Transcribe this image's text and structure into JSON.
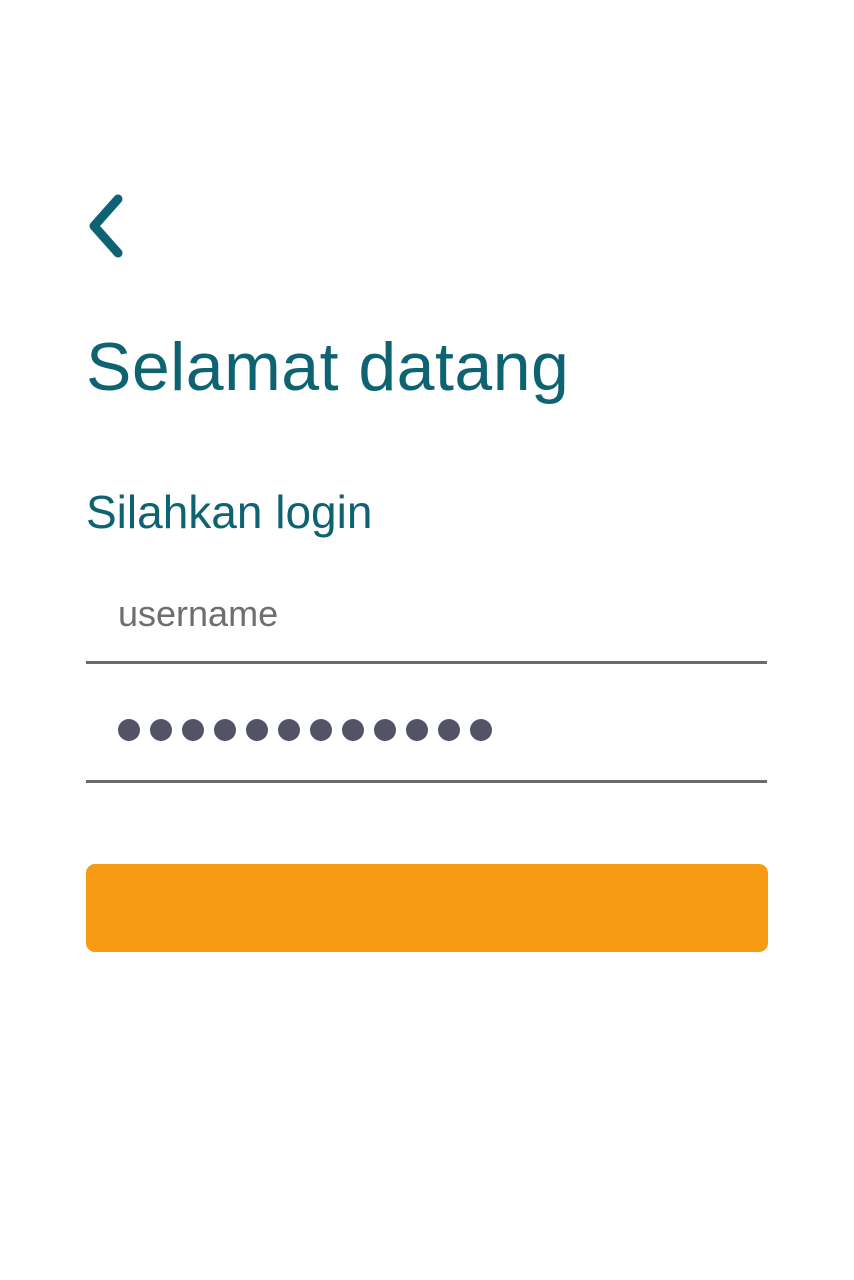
{
  "header": {
    "back_icon": "chevron-left-icon",
    "title": "Selamat datang",
    "subtitle": "Silahkan login"
  },
  "form": {
    "username": {
      "placeholder": "username",
      "value": ""
    },
    "password": {
      "masked_length": 12
    },
    "login_button": {
      "label": ""
    }
  },
  "colors": {
    "primary_text": "#0e6373",
    "accent_button": "#f79b14",
    "underline": "#6b6b6b",
    "mask_dot": "#525466"
  }
}
